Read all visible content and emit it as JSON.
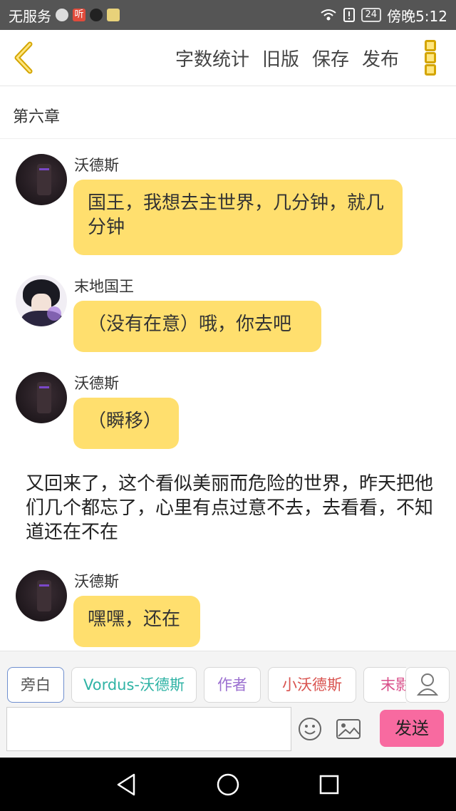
{
  "status_bar": {
    "carrier": "无服务",
    "app_icon_label": "听",
    "battery": "24",
    "time": "傍晚5:12"
  },
  "toolbar": {
    "actions": [
      "字数统计",
      "旧版",
      "保存",
      "发布"
    ]
  },
  "chapter_title": "第六章",
  "messages": [
    {
      "speaker": "沃德斯",
      "text": "国王，我想去主世界，几分钟，就几分钟"
    },
    {
      "speaker": "末地国王",
      "text": "（没有在意）哦，你去吧"
    },
    {
      "speaker": "沃德斯",
      "text": "（瞬移）"
    },
    {
      "speaker": "沃德斯",
      "text": "嘿嘿，还在"
    }
  ],
  "narration": "又回来了，这个看似美丽而危险的世界，昨天把他们几个都忘了，心里有点过意不去，去看看，不知道还在不在",
  "characters": [
    {
      "label": "旁白",
      "color": "#555555"
    },
    {
      "label": "Vordus-沃德斯",
      "color": "#2fb3a5"
    },
    {
      "label": "作者",
      "color": "#9b6fd0"
    },
    {
      "label": "小沃德斯",
      "color": "#d9534f"
    },
    {
      "label": "末影",
      "color": "#d94f8a"
    }
  ],
  "composer": {
    "input_value": "",
    "send_label": "发送"
  },
  "colors": {
    "bubble": "#ffdf6e",
    "accent": "#d4a500",
    "send": "#f86aa0"
  }
}
